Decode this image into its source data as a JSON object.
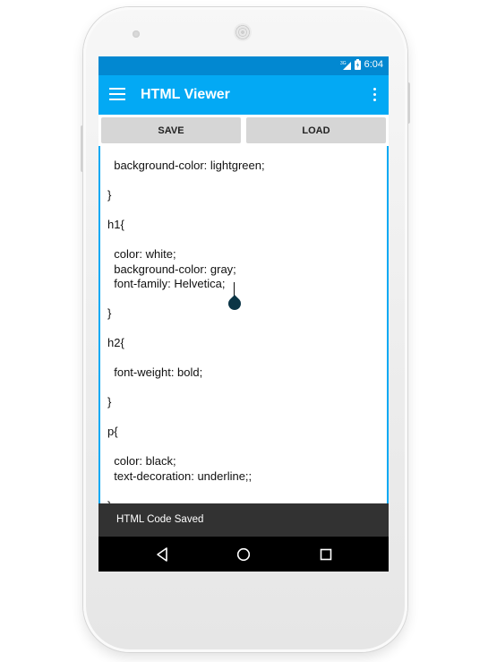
{
  "status_bar": {
    "network": "3G",
    "time": "6:04"
  },
  "app_bar": {
    "title": "HTML Viewer",
    "menu_icon": "menu-icon",
    "overflow_icon": "more-vert-icon"
  },
  "toolbar": {
    "save_label": "SAVE",
    "load_label": "LOAD"
  },
  "editor": {
    "content": "  background-color: lightgreen;\n\n}\n\nh1{\n\n  color: white;\n  background-color: gray;\n  font-family: Helvetica;\n\n}\n\nh2{\n\n  font-weight: bold;\n\n}\n\np{\n\n  color: black;\n  text-decoration: underline;;\n\n}"
  },
  "snackbar": {
    "message": "HTML Code Saved"
  },
  "nav": {
    "back_icon": "back-icon",
    "home_icon": "home-icon",
    "recents_icon": "recents-icon"
  },
  "colors": {
    "status_bar": "#0288d1",
    "app_bar": "#03a9f4",
    "accent": "#03a9f4",
    "snackbar": "#323232"
  }
}
